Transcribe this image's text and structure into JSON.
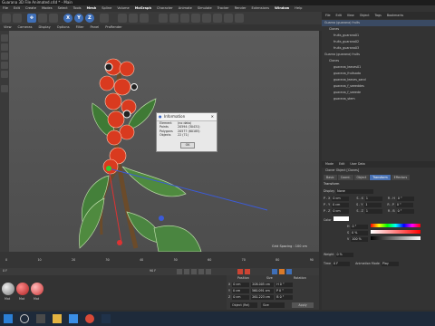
{
  "window": {
    "title": "Guarana 3D File Animated.c4d * - Main"
  },
  "menubar": {
    "items": [
      "File",
      "Edit",
      "Create",
      "Modes",
      "Select",
      "Tools",
      "Mesh",
      "Spline",
      "Volume",
      "MoGraph",
      "Character",
      "Animate",
      "Simulate",
      "Tracker",
      "Render",
      "Extensions",
      "Window",
      "Help"
    ]
  },
  "toolbar": {
    "axis": [
      "X",
      "Y",
      "Z"
    ]
  },
  "viewport_menu": {
    "items": [
      "View",
      "Cameras",
      "Display",
      "Options",
      "Filter",
      "Panel",
      "ProRender"
    ]
  },
  "viewport": {
    "grid_spacing": "Grid Spacing : 100 cm"
  },
  "info_dialog": {
    "title": "Information",
    "rows": [
      {
        "k": "Element",
        "v": "(no data)"
      },
      {
        "k": "Points",
        "v": "20594 (30431)"
      },
      {
        "k": "Polygons",
        "v": "20577 (60185)"
      },
      {
        "k": "Objects",
        "v": "22 (71)"
      }
    ],
    "ok_label": "OK"
  },
  "timeline": {
    "frames": [
      "0",
      "10",
      "20",
      "30",
      "40",
      "50",
      "60",
      "70",
      "80",
      "90"
    ],
    "current": "0 F",
    "end": "90 F"
  },
  "materials": {
    "items": [
      "Mat",
      "Mat",
      "Mat"
    ]
  },
  "coordinates": {
    "headers": [
      "Position",
      "Size",
      "Rotation"
    ],
    "rows": [
      {
        "axis": "X",
        "pos": "0 cm",
        "size": "208.005 cm",
        "rot": "H 0 °"
      },
      {
        "axis": "Y",
        "pos": "0 cm",
        "size": "560.091 cm",
        "rot": "P 0 °"
      },
      {
        "axis": "Z",
        "pos": "0 cm",
        "size": "261.223 cm",
        "rot": "B 0 °"
      }
    ],
    "mode": "Object (Rel)",
    "size_mode": "Size",
    "apply": "Apply"
  },
  "object_manager": {
    "menu": [
      "File",
      "Edit",
      "View",
      "Object",
      "Tags",
      "Bookmarks"
    ],
    "objects": [
      {
        "name": "Guarna (guarana) fruits",
        "indent": 0,
        "sel": true
      },
      {
        "name": "Clones",
        "indent": 1,
        "sel": false
      },
      {
        "name": "fruits_guarana01",
        "indent": 2,
        "sel": false
      },
      {
        "name": "fruits_guarana02",
        "indent": 2,
        "sel": false
      },
      {
        "name": "fruits_guarana03",
        "indent": 2,
        "sel": false
      },
      {
        "name": "Guarna (guarana) fruits",
        "indent": 0,
        "sel": false
      },
      {
        "name": "Clones",
        "indent": 1,
        "sel": false
      },
      {
        "name": "guarana_leaves01",
        "indent": 2,
        "sel": false
      },
      {
        "name": "guarana_fruitsada",
        "indent": 2,
        "sel": false
      },
      {
        "name": "guarana_leaves_sand",
        "indent": 2,
        "sel": false
      },
      {
        "name": "guarana_f_seeeddes",
        "indent": 2,
        "sel": false
      },
      {
        "name": "guarana_f_seeede",
        "indent": 2,
        "sel": false
      },
      {
        "name": "guarana_stem",
        "indent": 2,
        "sel": false
      }
    ]
  },
  "attributes": {
    "menu": [
      "Mode",
      "Edit",
      "User Data"
    ],
    "object_title": "Cloner Object [Clones]",
    "tabs": [
      {
        "label": "Basic",
        "active": false
      },
      {
        "label": "Coord.",
        "active": false
      },
      {
        "label": "Object",
        "active": false
      },
      {
        "label": "Transform",
        "active": true
      },
      {
        "label": "Effectors",
        "active": false
      }
    ],
    "section": "Transform",
    "display_label": "Display",
    "display_value": "None",
    "fields": [
      {
        "label": "P . X",
        "v": "0 cm"
      },
      {
        "label": "P . Y",
        "v": "0 cm"
      },
      {
        "label": "P . Z",
        "v": "0 cm"
      },
      {
        "label": "S . X",
        "v": "1"
      },
      {
        "label": "S . Y",
        "v": "1"
      },
      {
        "label": "S . Z",
        "v": "1"
      }
    ],
    "rot_fields": [
      {
        "label": "R . H",
        "v": "0 °"
      },
      {
        "label": "R . P",
        "v": "0 °"
      },
      {
        "label": "R . B",
        "v": "0 °"
      }
    ],
    "color_label": "Color",
    "hsv": [
      {
        "k": "H",
        "v": "0 °"
      },
      {
        "k": "S",
        "v": "0 %"
      },
      {
        "k": "V",
        "v": "100 %"
      }
    ],
    "weight_label": "Weight",
    "weight_value": "0 %",
    "time_label": "Time",
    "time_value": "0 F",
    "anim_mode_label": "Animation Mode",
    "anim_mode_value": "Play"
  },
  "colors": {
    "accent": "#4a73b5",
    "fruit": "#d93a1f",
    "leaf": "#4f8a3f"
  }
}
